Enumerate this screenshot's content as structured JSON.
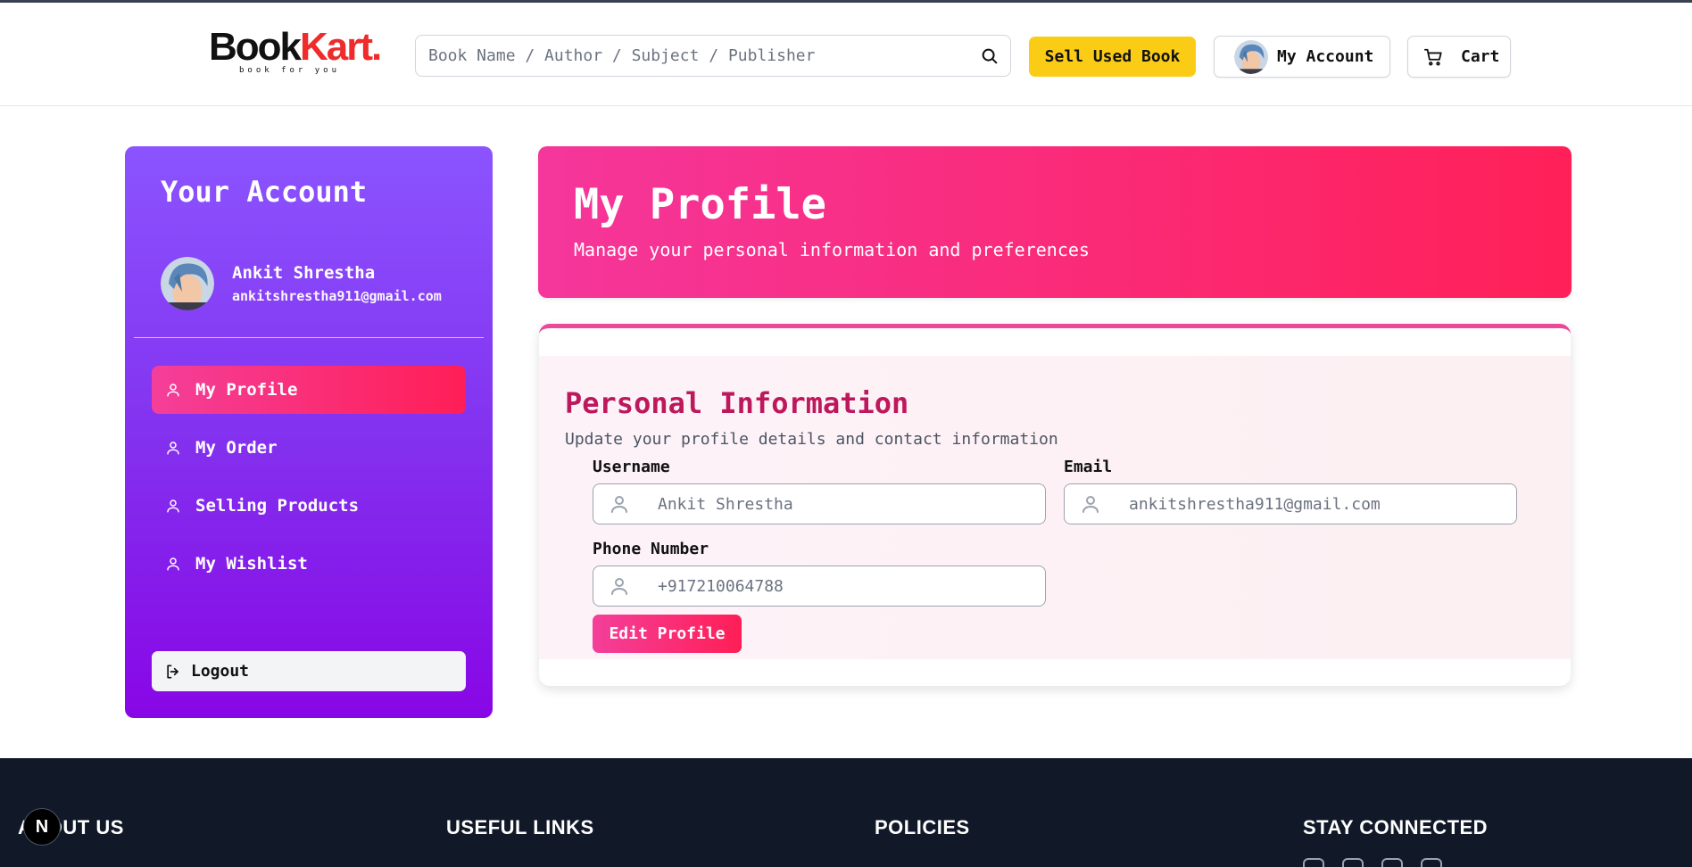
{
  "header": {
    "logo_main_a": "Book",
    "logo_main_b": "Kart.",
    "logo_tagline": "book for you",
    "search_placeholder": "Book Name / Author / Subject / Publisher",
    "sell_label": "Sell Used Book",
    "account_label": "My Account",
    "cart_label": "Cart"
  },
  "sidebar": {
    "title": "Your Account",
    "user_name": "Ankit Shrestha",
    "user_email": "ankitshrestha911@gmail.com",
    "items": [
      {
        "label": "My Profile",
        "icon": "user-icon",
        "active": true
      },
      {
        "label": "My Order",
        "icon": "user-icon",
        "active": false
      },
      {
        "label": "Selling Products",
        "icon": "user-icon",
        "active": false
      },
      {
        "label": "My Wishlist",
        "icon": "user-icon",
        "active": false
      }
    ],
    "logout_label": "Logout"
  },
  "banner": {
    "title": "My Profile",
    "subtitle": "Manage your personal information and preferences"
  },
  "profile_card": {
    "title": "Personal Information",
    "subtitle": "Update your profile details and contact information",
    "fields": {
      "username": {
        "label": "Username",
        "value": "Ankit Shrestha"
      },
      "email": {
        "label": "Email",
        "value": "ankitshrestha911@gmail.com"
      },
      "phone": {
        "label": "Phone Number",
        "value": "+917210064788"
      }
    },
    "edit_label": "Edit Profile"
  },
  "footer": {
    "headings": [
      "ABOUT US",
      "USEFUL LINKS",
      "POLICIES",
      "STAY CONNECTED"
    ]
  },
  "dev_badge": "N",
  "colors": {
    "accent_pink": "#f43f9a",
    "accent_red": "#ff1e56",
    "sidebar_purple": "#8b54ff",
    "sell_yellow": "#facc15",
    "footer_bg": "#111827",
    "card_title": "#be185d"
  }
}
